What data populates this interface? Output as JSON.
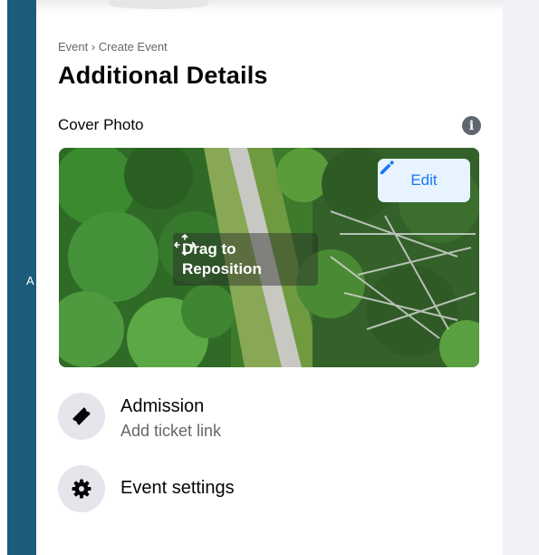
{
  "left_strip": {
    "text": "A"
  },
  "breadcrumb": "Event › Create Event",
  "page_title": "Additional Details",
  "cover_photo": {
    "label": "Cover Photo",
    "edit_label": "Edit",
    "drag_line1": "Drag to",
    "drag_line2": "Reposition"
  },
  "options": [
    {
      "title": "Admission",
      "subtitle": "Add ticket link",
      "icon": "ticket-icon"
    },
    {
      "title": "Event settings",
      "icon": "gear-icon"
    }
  ],
  "colors": {
    "accent": "#1877f2",
    "edit_bg": "#e7f3ff",
    "secondary_text": "#65676b",
    "icon_circle": "#e4e6eb",
    "left_strip": "#1d5b7a"
  }
}
